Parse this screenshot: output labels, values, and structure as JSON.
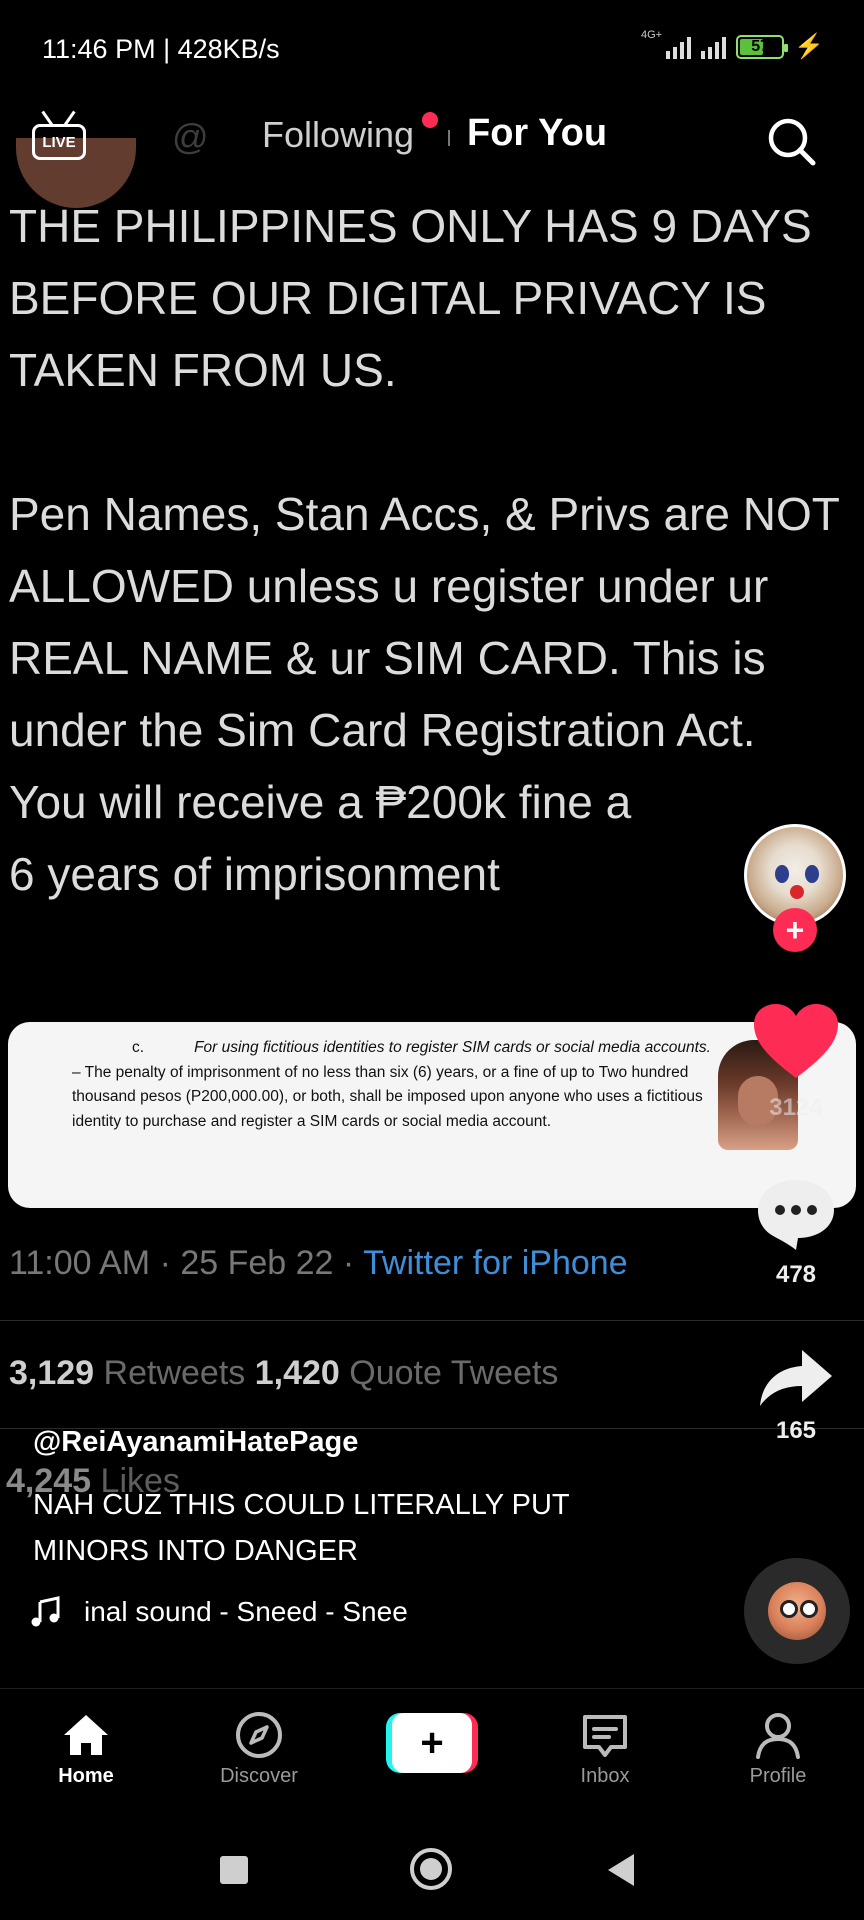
{
  "status_bar": {
    "time": "11:46 PM | 428KB/s",
    "network_type": "4G+",
    "battery_level": "57",
    "battery_fraction": 0.57
  },
  "top_nav": {
    "live_label": "LIVE",
    "tab_following": "Following",
    "tab_for_you": "For You",
    "active_tab": "For You",
    "notification_dot_color": "#fe2c55"
  },
  "video": {
    "ghost_handle": "@",
    "tweet_text": "THE PHILIPPINES ONLY HAS 9 DAYS BEFORE OUR DIGITAL PRIVACY IS TAKEN FROM US.\n\nPen Names, Stan Accs, & Privs are NOT ALLOWED unless u register under ur REAL NAME & ur SIM CARD. This is under the Sim Card Registration Act.\nYou will receive a ₱200k fine a\n6 years of imprisonment",
    "quote": {
      "letter": "c.",
      "italic_part": "For using fictitious identities to register SIM cards or social media accounts.",
      "body": " – The penalty of imprisonment of no less than six (6) years, or a fine of up to Two hundred thousand pesos (P200,000.00), or both, shall be imposed upon anyone who uses a fictitious identity to purchase and register a SIM cards or social media account."
    },
    "tweet_time": "11:00 AM · 25 Feb 22 · ",
    "tweet_source": "Twitter for iPhone",
    "retweets_count": "3,129",
    "retweets_label": " Retweets ",
    "quote_count": "1,420",
    "quote_label": " Quote Tweets",
    "likes_count": "4,245",
    "likes_label": " Likes"
  },
  "right_rail": {
    "like_count": "3124",
    "comment_count": "478",
    "share_count": "165",
    "like_color": "#fe2c55"
  },
  "caption": {
    "username": "@ReiAyanamiHatePage",
    "text": "NAH CUZ THIS COULD LITERALLY PUT MINORS INTO DANGER",
    "sound": "inal sound - Sneed - Snee"
  },
  "bottom_nav": {
    "home": "Home",
    "discover": "Discover",
    "create": "+",
    "inbox": "Inbox",
    "profile": "Profile",
    "active": "Home"
  },
  "icons": {
    "live": "live-tv-icon",
    "search": "search-icon",
    "like": "heart-icon",
    "comment": "comment-bubble-icon",
    "share": "share-arrow-icon",
    "music": "music-note-icon",
    "home": "home-icon",
    "discover": "compass-icon",
    "inbox": "inbox-icon",
    "profile": "profile-icon"
  },
  "colors": {
    "accent_red": "#fe2c55",
    "accent_cyan": "#25f4ee",
    "twitter_blue": "#3f8fd8"
  }
}
